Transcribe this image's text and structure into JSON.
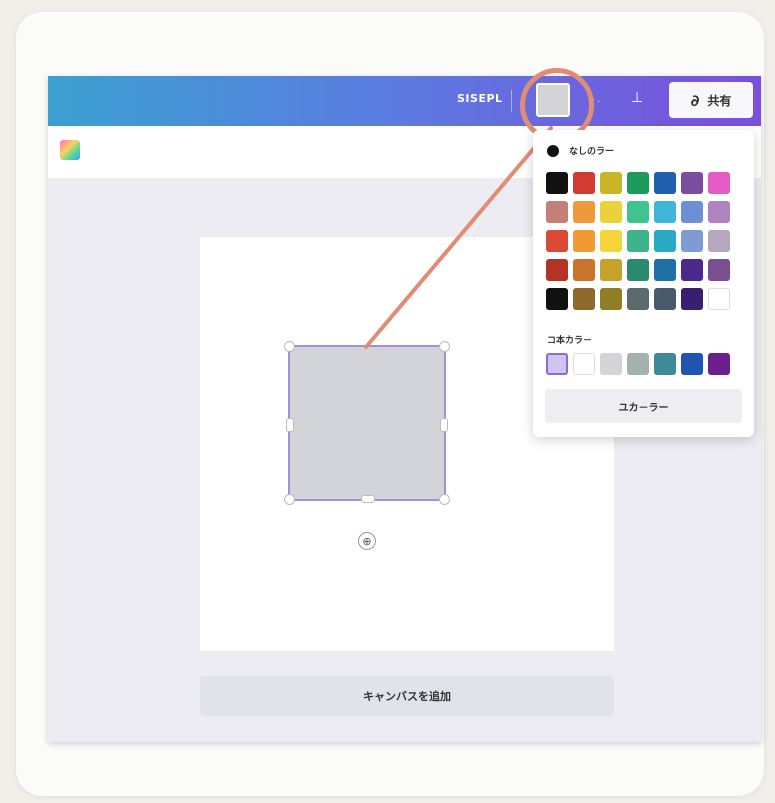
{
  "topbar": {
    "resize_label": "SISEPL",
    "faded_label": "ｔ·",
    "download_icon": "download-icon",
    "share_icon": "∂",
    "share_label": "共有"
  },
  "canvas": {
    "rotate_icon": "⊕",
    "add_page_label": "キャンバスを追加"
  },
  "color_picker": {
    "title": "なしのラー",
    "palette_rows": [
      [
        "#111111",
        "#d23b32",
        "#c8b628",
        "#1e9a5c",
        "#1f5fb0",
        "#7b4ca0",
        "#e45bc7"
      ],
      [
        "#c18078",
        "#ee9a3c",
        "#ead33a",
        "#3fc391",
        "#3fb6d7",
        "#6d8fd4",
        "#b084c0"
      ],
      [
        "#d84a36",
        "#f19a34",
        "#f1d53a",
        "#3fb38b",
        "#2aa9c5",
        "#7e9bd4",
        "#b7a6c0"
      ],
      [
        "#b33325",
        "#c9742c",
        "#c8a12c",
        "#2a8a6c",
        "#1f70a4",
        "#4b2a8c",
        "#7a4f90"
      ],
      [
        "#111111",
        "#8f6a2a",
        "#8f7e25",
        "#5a6b6e",
        "#4a5a6e",
        "#3a1f70",
        "#ffffff"
      ]
    ],
    "doc_colors_title": "コ本カラ－",
    "doc_colors": [
      "#cfc5ee",
      "#ffffff",
      "#d4d4d8",
      "#a4b1ac",
      "#3f8a99",
      "#1f55b0",
      "#6e1f8e"
    ],
    "custom_label": "ユカ－ラー"
  }
}
